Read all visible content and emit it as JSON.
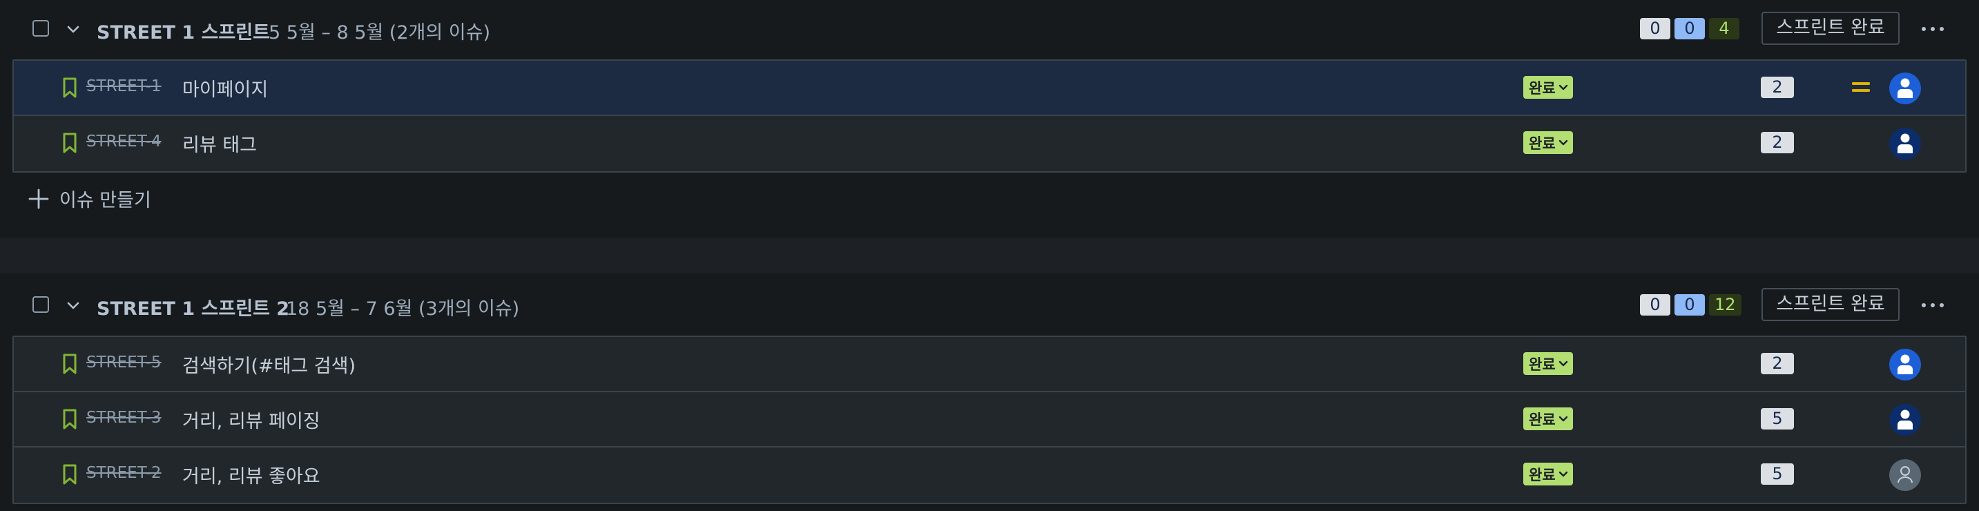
{
  "sprints": [
    {
      "title": "STREET 1 스프린트",
      "meta": "5 5월 – 8 5월 (2개의 이슈)",
      "counts": {
        "todo": "0",
        "in_progress": "0",
        "done": "4"
      },
      "complete_label": "스프린트 완료",
      "issues": [
        {
          "key": "STREET-1",
          "summary": "마이페이지",
          "status": "완료",
          "points": "2",
          "priority": "medium",
          "avatar": "blue"
        },
        {
          "key": "STREET-4",
          "summary": "리뷰 태그",
          "status": "완료",
          "points": "2",
          "priority": "",
          "avatar": "navy"
        }
      ],
      "create_label": "이슈 만들기"
    },
    {
      "title": "STREET 1 스프린트 2",
      "meta": "18 5월 – 7 6월 (3개의 이슈)",
      "counts": {
        "todo": "0",
        "in_progress": "0",
        "done": "12"
      },
      "complete_label": "스프린트 완료",
      "issues": [
        {
          "key": "STREET-5",
          "summary": "검색하기(#태그 검색)",
          "status": "완료",
          "points": "2",
          "priority": "",
          "avatar": "blue"
        },
        {
          "key": "STREET-3",
          "summary": "거리, 리뷰 페이징",
          "status": "완료",
          "points": "5",
          "priority": "",
          "avatar": "navy"
        },
        {
          "key": "STREET-2",
          "summary": "거리, 리뷰 좋아요",
          "status": "완료",
          "points": "5",
          "priority": "",
          "avatar": "unassigned"
        }
      ]
    }
  ],
  "colors": {
    "done_status": "#b3df72",
    "story_icon": "#82b536",
    "priority_medium": "#e2b203",
    "avatar_blue": "#1d5fd6",
    "avatar_navy": "#0c2d6b"
  }
}
